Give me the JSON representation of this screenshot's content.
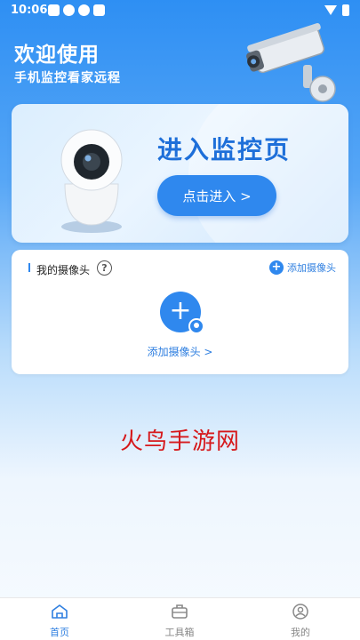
{
  "status_bar": {
    "time": "10:06"
  },
  "header": {
    "title": "欢迎使用",
    "subtitle": "手机监控看家远程"
  },
  "banner": {
    "title": "进入监控页",
    "button_label": "点击进入 >"
  },
  "camera_section": {
    "title": "我的摄像头",
    "help_symbol": "?",
    "add_link_label": "添加摄像头",
    "add_button_symbol": "+",
    "add_center_label": "添加摄像头 >"
  },
  "watermark": {
    "text": "火鸟手游网"
  },
  "bottom_nav": {
    "items": [
      {
        "label": "首页",
        "icon": "home-icon",
        "active": true
      },
      {
        "label": "工具箱",
        "icon": "toolbox-icon",
        "active": false
      },
      {
        "label": "我的",
        "icon": "profile-icon",
        "active": false
      }
    ]
  },
  "colors": {
    "accent": "#2f88ee",
    "watermark": "#d6181b"
  }
}
